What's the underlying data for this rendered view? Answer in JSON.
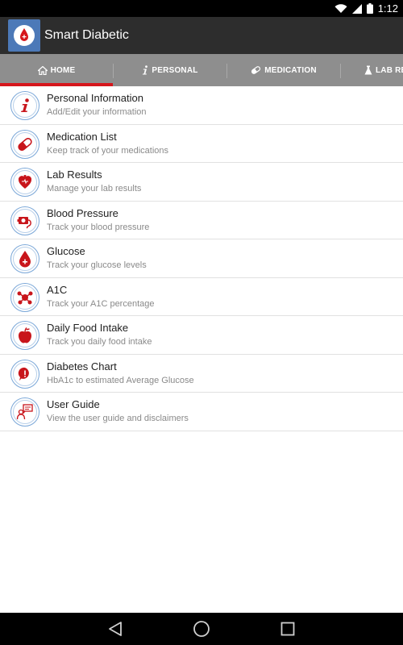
{
  "status_bar": {
    "time": "1:12",
    "icons": [
      "wifi-icon",
      "signal-icon",
      "battery-icon"
    ]
  },
  "app": {
    "title": "Smart Diabetic",
    "logo_icon": "blood-drop-icon",
    "bar_color": "#2d2d2d",
    "logo_color": "#4c79b8"
  },
  "tabs": [
    {
      "label": "HOME",
      "icon": "home-icon",
      "selected": true
    },
    {
      "label": "PERSONAL",
      "icon": "info-icon",
      "selected": false
    },
    {
      "label": "MEDICATION",
      "icon": "pill-icon",
      "selected": false
    },
    {
      "label": "LAB RE",
      "icon": "lab-icon",
      "selected": false
    }
  ],
  "accent_color": "#d6161c",
  "menu": [
    {
      "title": "Personal Information",
      "subtitle": "Add/Edit your information",
      "icon": "info-icon"
    },
    {
      "title": "Medication List",
      "subtitle": "Keep track of your medications",
      "icon": "pill-icon"
    },
    {
      "title": "Lab Results",
      "subtitle": "Manage your lab results",
      "icon": "heart-icon"
    },
    {
      "title": "Blood Pressure",
      "subtitle": "Track your blood pressure",
      "icon": "blood-pressure-icon"
    },
    {
      "title": "Glucose",
      "subtitle": "Track your glucose levels",
      "icon": "glucose-drop-icon"
    },
    {
      "title": "A1C",
      "subtitle": "Track your A1C percentage",
      "icon": "molecule-icon"
    },
    {
      "title": "Daily Food Intake",
      "subtitle": "Track you daily food intake",
      "icon": "apple-icon"
    },
    {
      "title": "Diabetes Chart",
      "subtitle": "HbA1c to estimated Average Glucose",
      "icon": "chart-bubble-icon"
    },
    {
      "title": "User Guide",
      "subtitle": "View the user guide and disclaimers",
      "icon": "user-guide-icon"
    }
  ],
  "nav_bar": {
    "buttons": [
      "back-icon",
      "home-circle-icon",
      "recents-icon"
    ]
  }
}
